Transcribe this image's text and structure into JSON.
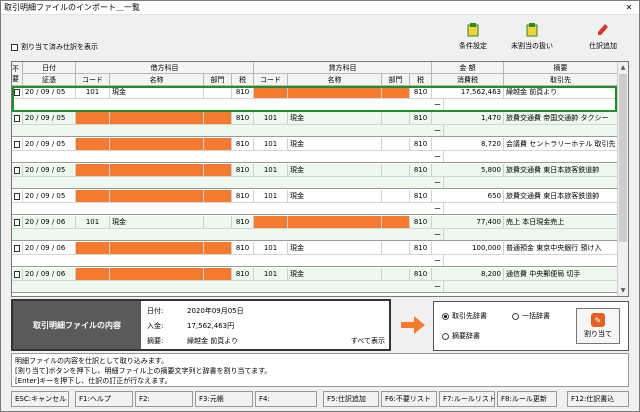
{
  "window": {
    "title": "取引明細ファイルのインポート＿一覧"
  },
  "toolbar": {
    "unassigned_label": "割り当て済み仕訳を表示",
    "conditions_label": "条件設定",
    "unassigned_handling_label": "未割当の扱い",
    "add_entry_label": "仕訳追加"
  },
  "grid": {
    "headers": {
      "unneeded": "不要",
      "date": "日付",
      "voucher": "証憑",
      "debit": "借方科目",
      "credit": "貸方科目",
      "code": "コード",
      "name": "名称",
      "dept": "部門",
      "tax": "税",
      "amount": "金 額",
      "tax_amount": "消費税",
      "summary": "摘要",
      "partner": "取引先"
    },
    "rows": [
      {
        "date": "20 / 09 / 05",
        "dcode": "101",
        "dname": "現金",
        "dtax": "810",
        "ccode": "",
        "cname": "",
        "ctax": "810",
        "amount": "17,562,463",
        "summary": "繰越金 前頁より",
        "debit_orange": false,
        "credit_orange": true
      },
      {
        "date": "20 / 09 / 05",
        "dcode": "",
        "dname": "",
        "dtax": "810",
        "ccode": "101",
        "cname": "現金",
        "ctax": "810",
        "amount": "1,470",
        "summary": "旅費交通費 帝国交通帥 タクシー",
        "debit_orange": true,
        "credit_orange": false
      },
      {
        "date": "20 / 09 / 05",
        "dcode": "",
        "dname": "",
        "dtax": "810",
        "ccode": "101",
        "cname": "現金",
        "ctax": "810",
        "amount": "8,720",
        "summary": "会議費 セントラリーホテル 取引先　打",
        "debit_orange": true,
        "credit_orange": false
      },
      {
        "date": "20 / 09 / 05",
        "dcode": "",
        "dname": "",
        "dtax": "810",
        "ccode": "101",
        "cname": "現金",
        "ctax": "810",
        "amount": "5,800",
        "summary": "旅費交通費 東日本旅客鉄道帥",
        "debit_orange": true,
        "credit_orange": false
      },
      {
        "date": "20 / 09 / 05",
        "dcode": "",
        "dname": "",
        "dtax": "810",
        "ccode": "101",
        "cname": "現金",
        "ctax": "810",
        "amount": "650",
        "summary": "旅費交通費 東日本旅客鉄道帥",
        "debit_orange": true,
        "credit_orange": false
      },
      {
        "date": "20 / 09 / 06",
        "dcode": "101",
        "dname": "現金",
        "dtax": "810",
        "ccode": "",
        "cname": "",
        "ctax": "810",
        "amount": "77,400",
        "summary": "売上 本日現金売上",
        "debit_orange": false,
        "credit_orange": true
      },
      {
        "date": "20 / 09 / 06",
        "dcode": "",
        "dname": "",
        "dtax": "810",
        "ccode": "101",
        "cname": "現金",
        "ctax": "810",
        "amount": "100,000",
        "summary": "普通預金 東京中央銀行 預け入",
        "debit_orange": true,
        "credit_orange": false
      },
      {
        "date": "20 / 09 / 06",
        "dcode": "",
        "dname": "",
        "dtax": "810",
        "ccode": "101",
        "cname": "現金",
        "ctax": "810",
        "amount": "8,200",
        "summary": "通信費 中央郵便局 切手",
        "debit_orange": true,
        "credit_orange": false
      }
    ],
    "dash": "ー"
  },
  "detail": {
    "box_label": "取引明細ファイルの内容",
    "date_label": "日付:",
    "date_value": "2020年09月05日",
    "in_label": "入金:",
    "in_value": "17,562,463円",
    "summary_label": "摘要:",
    "summary_value": "繰越金 前頁より",
    "show_all": "すべて表示"
  },
  "dict": {
    "partner_dict": "取引先辞書",
    "batch_dict": "一括辞書",
    "summary_dict": "摘要辞書",
    "assign_label": "割り当て"
  },
  "message": {
    "line1": "明細ファイルの内容を仕訳として取り込みます。",
    "line2": "[割り当て]ボタンを押下し、明細ファイル上の摘要文字列と辞書を割り当てます。",
    "line3": "[Enter]キーを押下し、仕訳の訂正が行なえます。"
  },
  "fkeys": [
    "ESC:キャンセル",
    "F1:ヘルプ",
    "F2:",
    "F3:元帳",
    "F4:",
    "F5:仕訳追加",
    "F6:不要リスト",
    "F7:ルールリスト",
    "F8:ルール更新",
    "F12:仕訳書込"
  ],
  "colors": {
    "orange": "#f57a2e",
    "selected": "#1f8f2a",
    "alt_row": "#eef8ee"
  }
}
